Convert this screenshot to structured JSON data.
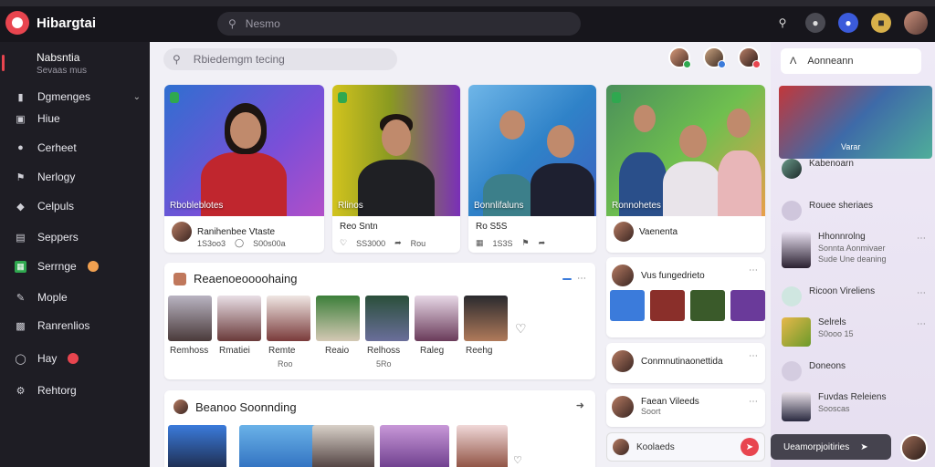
{
  "app": {
    "title": "Hibargtai"
  },
  "topbar": {
    "search_placeholder": "Nesmo",
    "icons": [
      "search-icon",
      "globe-icon",
      "notification-icon",
      "gift-icon",
      "user-avatar"
    ]
  },
  "sidebar": {
    "profile": {
      "name": "Nabsntia",
      "sub": "Sevaas mus"
    },
    "items": [
      {
        "label": "Dgmenges",
        "icon": "folder-icon",
        "has_chevron": true
      },
      {
        "label": "Hiue",
        "icon": "home-icon"
      },
      {
        "label": "Cerheet",
        "icon": "user-icon"
      },
      {
        "label": "Nerlogy",
        "icon": "flag-icon"
      },
      {
        "label": "Celpuls",
        "icon": "shield-icon"
      },
      {
        "label": "Seppers",
        "icon": "list-icon"
      },
      {
        "label": "Serrnge",
        "icon": "grid-icon",
        "badge": "orange"
      },
      {
        "label": "Mople",
        "icon": "pen-icon"
      },
      {
        "label": "Ranrenlios",
        "icon": "chat-icon"
      },
      {
        "label": "Hay",
        "icon": "help-icon",
        "badge": "red"
      },
      {
        "label": "Rehtorg",
        "icon": "settings-icon"
      }
    ]
  },
  "main": {
    "search_placeholder": "Rbiedemgm tecing",
    "videos": [
      {
        "tag": "",
        "caption": "Rbobleblotes",
        "title": "Ranihenbee Vtaste",
        "stat1": "1S3oo3",
        "stat2": "S00s00a"
      },
      {
        "tag": "",
        "caption": "Rlinos",
        "title": "Reo Sntn",
        "stat1": "SS3000",
        "stat2": "Rou"
      },
      {
        "tag": "",
        "caption": "Bonnlifaluns",
        "title": "Ro S5S",
        "stat1": "1S3S",
        "stat2": ""
      },
      {
        "tag": "",
        "caption": "Ronnohetes",
        "title": "Vaenenta",
        "stat1": "",
        "stat2": ""
      }
    ],
    "recommend": {
      "title": "Reaenoeoooohaing",
      "badge": "",
      "people": [
        {
          "name": "Remhoss",
          "stat": ""
        },
        {
          "name": "Rmatiei",
          "stat": ""
        },
        {
          "name": "Remte",
          "stat": ""
        },
        {
          "name": "Reaio",
          "stat": ""
        },
        {
          "name": "Relhoss",
          "stat": "5Ro"
        },
        {
          "name": "Raleg",
          "stat": ""
        },
        {
          "name": "Reehg",
          "stat": ""
        }
      ],
      "stats_row": [
        "",
        "",
        "Roo",
        ""
      ]
    },
    "second": {
      "title": "Beanoo Soonnding"
    },
    "rcards": [
      {
        "title": "Vus fungedrieto"
      },
      {
        "title": "Conmnutinaonettida"
      },
      {
        "title": "Faean Vileeds",
        "sub": "Soort"
      }
    ],
    "chat": {
      "label": "Koolaeds"
    }
  },
  "rpanel": {
    "button_label": "Aonneann",
    "hero_caption": "Varar",
    "items": [
      {
        "title": "Kabenoarn",
        "sub": ""
      },
      {
        "title": "Rouee sheriaes",
        "sub": ""
      },
      {
        "title": "Hhonnrolng",
        "sub": "Sonnta Aonmivaer",
        "sub2": "Sude Une deaning"
      },
      {
        "title": "Ricoon Vireliens",
        "sub": ""
      },
      {
        "title": "Selrels",
        "sub": "S0ooo 15"
      },
      {
        "title": "Doneons",
        "sub": ""
      },
      {
        "title": "Fuvdas Releiens",
        "sub": "Sooscas"
      }
    ],
    "footer_label": "Ueamorpjoitiries"
  },
  "colors": {
    "accent": "#e8454f",
    "sidebar_bg": "#1e1d24",
    "main_bg": "#f1f0f6",
    "rpanel_bg": "#ece6f4"
  }
}
